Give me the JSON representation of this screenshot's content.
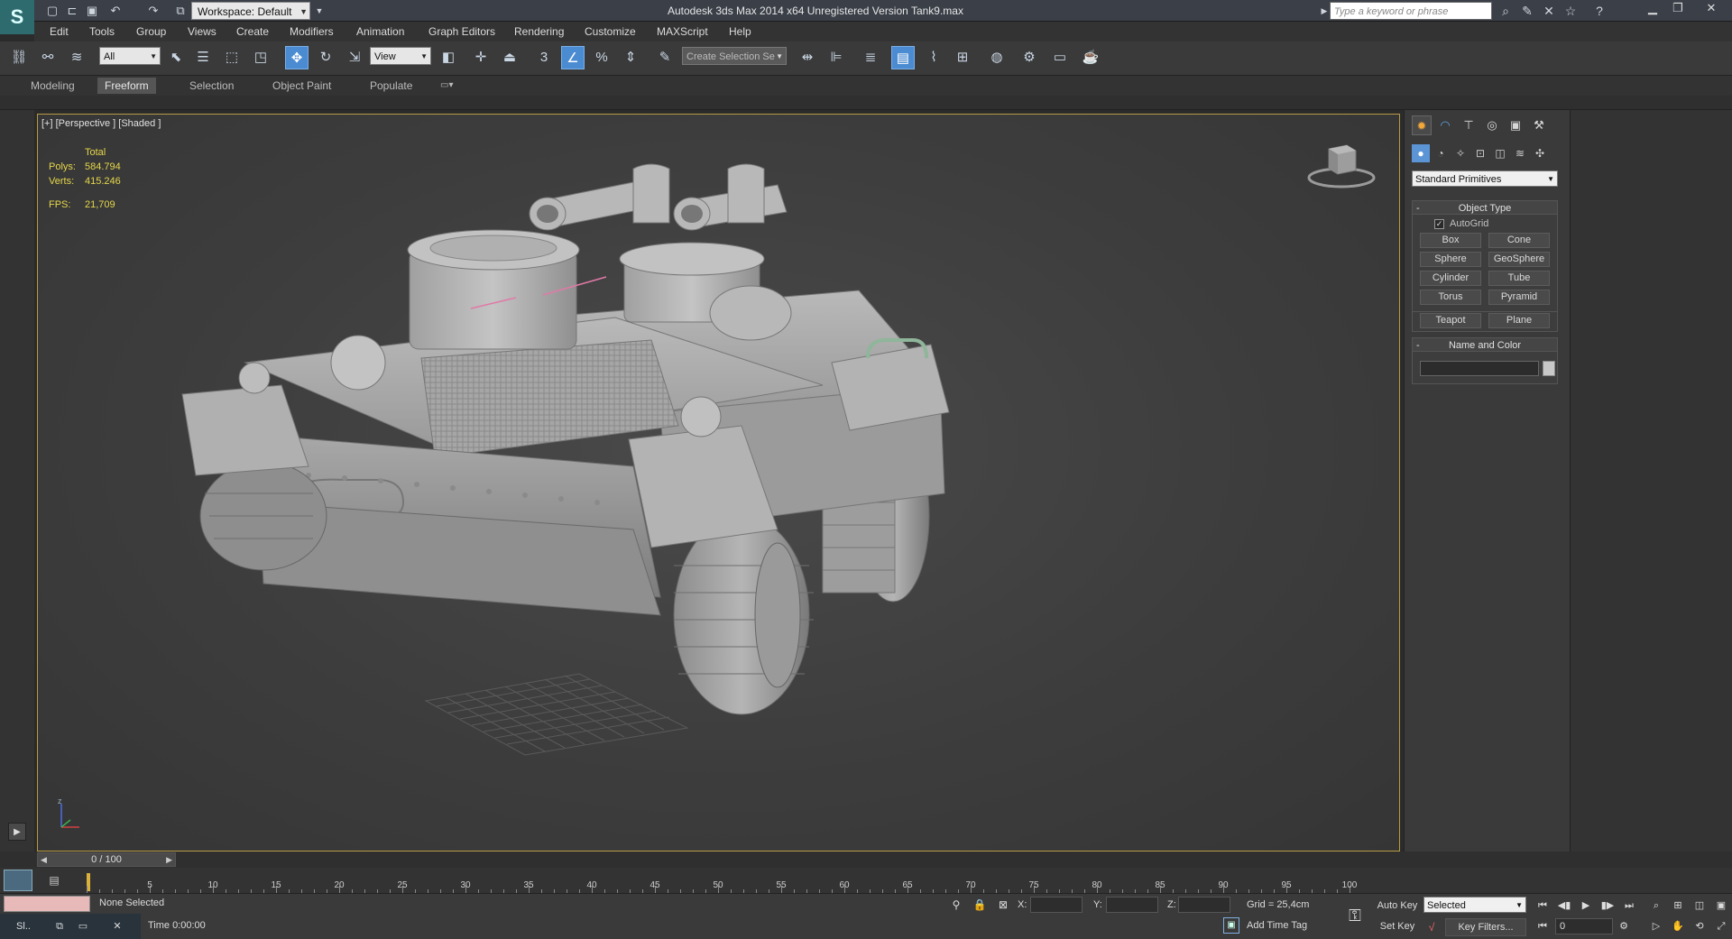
{
  "window": {
    "title": "Autodesk 3ds Max  2014 x64    Unregistered Version    Tank9.max",
    "workspace": "Workspace: Default",
    "search_placeholder": "Type a keyword or phrase"
  },
  "menu": [
    "Edit",
    "Tools",
    "Group",
    "Views",
    "Create",
    "Modifiers",
    "Animation",
    "Graph Editors",
    "Rendering",
    "Customize",
    "MAXScript",
    "Help"
  ],
  "toolbar": {
    "filter": "All",
    "ref_coord": "View",
    "snap_label": "3",
    "selection_set_placeholder": "Create Selection Se"
  },
  "ribbon": {
    "tabs": [
      "Modeling",
      "Freeform",
      "Selection",
      "Object Paint",
      "Populate"
    ],
    "active": "Freeform"
  },
  "viewport": {
    "label": "[+] [Perspective ] [Shaded ]",
    "stats": {
      "header": "Total",
      "polys_label": "Polys:",
      "polys": "584.794",
      "verts_label": "Verts:",
      "verts": "415.246",
      "fps_label": "FPS:",
      "fps": "21,709"
    },
    "axis_z": "z"
  },
  "command_panel": {
    "primitive_type": "Standard Primitives",
    "object_type_title": "Object Type",
    "autogrid_label": "AutoGrid",
    "buttons": [
      "Box",
      "Cone",
      "Sphere",
      "GeoSphere",
      "Cylinder",
      "Tube",
      "Torus",
      "Pyramid",
      "Teapot",
      "Plane"
    ],
    "name_color_title": "Name and Color"
  },
  "timeline": {
    "slider": "0 / 100",
    "ruler_labels": [
      "5",
      "10",
      "15",
      "20",
      "25",
      "30",
      "35",
      "40",
      "45",
      "50",
      "55",
      "60",
      "65",
      "70",
      "75",
      "80",
      "85",
      "90",
      "95",
      "100"
    ]
  },
  "status": {
    "selection": "None Selected",
    "time": "Time  0:00:00",
    "x_label": "X:",
    "y_label": "Y:",
    "z_label": "Z:",
    "grid": "Grid = 25,4cm",
    "add_time_tag": "Add Time Tag",
    "auto_key": "Auto Key",
    "set_key": "Set Key",
    "selected_dd": "Selected",
    "key_filters": "Key Filters...",
    "frame": "0",
    "taskbar_app": "Sl.."
  }
}
